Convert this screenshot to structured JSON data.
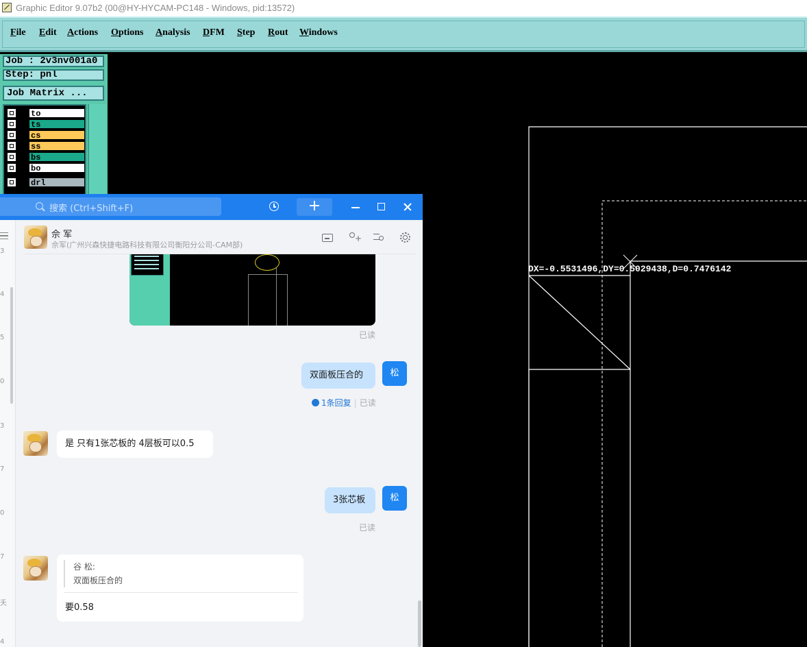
{
  "editor": {
    "title": "Graphic Editor 9.07b2 (00@HY-HYCAM-PC148 - Windows, pid:13572)",
    "menu": [
      {
        "first": "F",
        "rest": "ile"
      },
      {
        "first": "E",
        "rest": "dit"
      },
      {
        "first": "A",
        "rest": "ctions"
      },
      {
        "first": "O",
        "rest": "ptions"
      },
      {
        "first": "A",
        "rest": "nalysis"
      },
      {
        "first": "D",
        "rest": "FM"
      },
      {
        "first": "S",
        "rest": "tep"
      },
      {
        "first": "R",
        "rest": "out"
      },
      {
        "first": "W",
        "rest": "indows"
      }
    ],
    "job": "Job : 2v3nv001a0",
    "step": "Step: pnl",
    "job_matrix_label": "Job Matrix ...",
    "layers": [
      {
        "name": "to",
        "color": "#ffffff"
      },
      {
        "name": "ts",
        "color": "#1aa98a"
      },
      {
        "name": "cs",
        "color": "#ffc95a"
      },
      {
        "name": "ss",
        "color": "#ffc95a"
      },
      {
        "name": "bs",
        "color": "#1aa98a"
      },
      {
        "name": "bo",
        "color": "#ffffff"
      },
      {
        "name": "drl",
        "color": "#a9b8be"
      }
    ],
    "measurement": "DX=-0.5531496,DY=0.5029438,D=0.7476142"
  },
  "chat": {
    "search_placeholder": "搜索 (Ctrl+Shift+F)",
    "plus_label": "+",
    "contact": {
      "name": "佘 军",
      "subtitle": "佘军(广州兴森快捷电路科技有限公司衡阳分公司-CAM部)"
    },
    "side_numbers": [
      "3",
      "4",
      "5",
      "0",
      "3",
      "7",
      "0",
      "7",
      "夭",
      "4"
    ],
    "me_initial": "松",
    "read_label": "已读",
    "messages": [
      {
        "from": "me",
        "text": "双面板压合的",
        "replies": "1条回复",
        "status": "已读"
      },
      {
        "from": "them",
        "text": "是  只有1张芯板的  4层板可以0.5"
      },
      {
        "from": "me",
        "text": "3张芯板",
        "status": "已读"
      },
      {
        "from": "them",
        "quote_author": "谷 松:",
        "quote_text": "双面板压合的",
        "text": "要0.58"
      }
    ]
  }
}
